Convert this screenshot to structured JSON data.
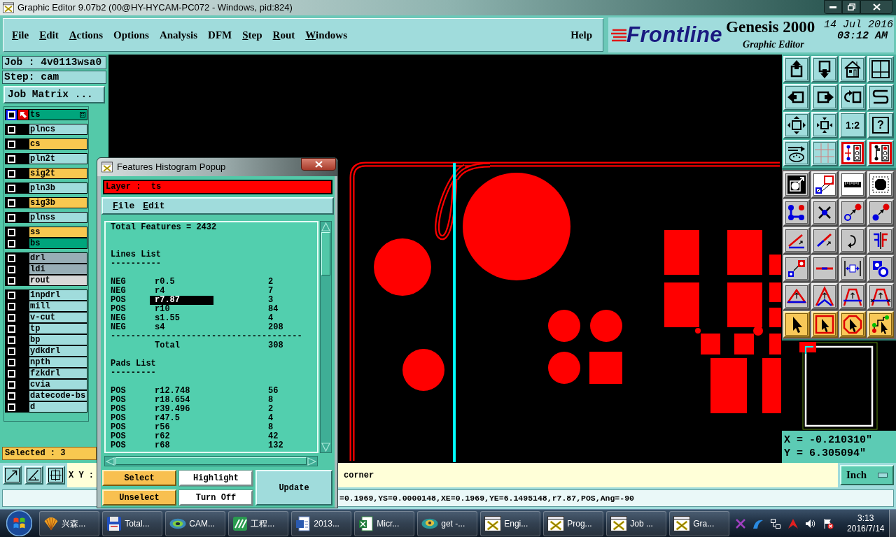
{
  "window": {
    "title": "Graphic Editor 9.07b2 (00@HY-HYCAM-PC072 - Windows, pid:824)"
  },
  "menu": [
    {
      "label": "File",
      "mnemonic": true
    },
    {
      "label": "Edit",
      "mnemonic": true
    },
    {
      "label": "Actions",
      "mnemonic": true
    },
    {
      "label": "Options",
      "mnemonic": false
    },
    {
      "label": "Analysis",
      "mnemonic": false
    },
    {
      "label": "DFM",
      "mnemonic": false
    },
    {
      "label": "Step",
      "mnemonic": true
    },
    {
      "label": "Rout",
      "mnemonic": true
    },
    {
      "label": "Windows",
      "mnemonic": true
    }
  ],
  "help_menu": {
    "label": "Help",
    "mnemonic": false
  },
  "brand": {
    "logo": "Frontline",
    "product": "Genesis 2000",
    "subtitle": "Graphic Editor",
    "date": "14 Jul 2016",
    "time": "03:12 AM"
  },
  "job_panel": {
    "job": "Job : 4v0113wsa0",
    "step": "Step: cam",
    "matrix_button": "Job Matrix ..."
  },
  "layer_groups": [
    {
      "layers": [
        {
          "name": "ts",
          "color": "#00a57c",
          "checked": false,
          "selected": true
        }
      ]
    },
    {
      "layers": [
        {
          "name": "plncs",
          "color": "#a0dcdc",
          "checked": false,
          "selected": false
        }
      ]
    },
    {
      "layers": [
        {
          "name": "cs",
          "color": "#f8c850",
          "checked": false,
          "selected": false
        }
      ]
    },
    {
      "layers": [
        {
          "name": "pln2t",
          "color": "#a0dcdc",
          "checked": false,
          "selected": false
        }
      ]
    },
    {
      "layers": [
        {
          "name": "sig2t",
          "color": "#f8c850",
          "checked": false,
          "selected": false
        }
      ]
    },
    {
      "layers": [
        {
          "name": "pln3b",
          "color": "#a0dcdc",
          "checked": false,
          "selected": false
        }
      ]
    },
    {
      "layers": [
        {
          "name": "sig3b",
          "color": "#f8c850",
          "checked": false,
          "selected": false
        }
      ]
    },
    {
      "layers": [
        {
          "name": "plnss",
          "color": "#a0dcdc",
          "checked": false,
          "selected": false
        }
      ]
    },
    {
      "layers": [
        {
          "name": "ss",
          "color": "#f8c850",
          "checked": false,
          "selected": false
        },
        {
          "name": "bs",
          "color": "#00a57c",
          "checked": false,
          "selected": false
        }
      ]
    },
    {
      "layers": [
        {
          "name": "drl",
          "color": "#98aeb6",
          "checked": false,
          "selected": false
        },
        {
          "name": "ldi",
          "color": "#98aeb6",
          "checked": false,
          "selected": false
        },
        {
          "name": "rout",
          "color": "#d8d8d8",
          "checked": false,
          "selected": false
        }
      ]
    },
    {
      "layers": [
        {
          "name": "1npdrl",
          "color": "#a0dcdc",
          "checked": false,
          "selected": false
        },
        {
          "name": "mill",
          "color": "#a0dcdc",
          "checked": false,
          "selected": false
        },
        {
          "name": "v-cut",
          "color": "#a0dcdc",
          "checked": false,
          "selected": false
        },
        {
          "name": "tp",
          "color": "#a0dcdc",
          "checked": false,
          "selected": false
        },
        {
          "name": "bp",
          "color": "#a0dcdc",
          "checked": false,
          "selected": false
        },
        {
          "name": "ydkdrl",
          "color": "#a0dcdc",
          "checked": false,
          "selected": false
        },
        {
          "name": "npth",
          "color": "#a0dcdc",
          "checked": false,
          "selected": false
        },
        {
          "name": "fzkdrl",
          "color": "#a0dcdc",
          "checked": false,
          "selected": false
        },
        {
          "name": "cvia",
          "color": "#a0dcdc",
          "checked": false,
          "selected": false
        },
        {
          "name": "datecode-bs",
          "color": "#a0dcdc",
          "checked": false,
          "selected": false
        },
        {
          "name": "d",
          "color": "#a0dcdc",
          "checked": false,
          "selected": false
        }
      ]
    }
  ],
  "selected_count": "Selected : 3",
  "histogram_popup": {
    "title": "Features Histogram Popup",
    "layer": "Layer :  ts",
    "menu": [
      {
        "label": "File",
        "mnemonic": true
      },
      {
        "label": "Edit",
        "mnemonic": true
      }
    ],
    "total": "Total Features = 2432",
    "sections": [
      {
        "title": "Lines List",
        "underline": "----------",
        "rows": [
          {
            "polarity": "NEG",
            "symbol": "r0.5",
            "count": "2",
            "selected": false
          },
          {
            "polarity": "NEG",
            "symbol": "r4",
            "count": "7",
            "selected": false
          },
          {
            "polarity": "POS",
            "symbol": "r7.87",
            "count": "3",
            "selected": true
          },
          {
            "polarity": "POS",
            "symbol": "r10",
            "count": "84",
            "selected": false
          },
          {
            "polarity": "NEG",
            "symbol": "s1.55",
            "count": "4",
            "selected": false
          },
          {
            "polarity": "NEG",
            "symbol": "s4",
            "count": "208",
            "selected": false
          }
        ],
        "rule": "--------------------------------------",
        "total_label": "Total",
        "total": "308"
      },
      {
        "title": "Pads List",
        "underline": "---------",
        "rows": [
          {
            "polarity": "POS",
            "symbol": "r12.748",
            "count": "56",
            "selected": false
          },
          {
            "polarity": "POS",
            "symbol": "r18.654",
            "count": "8",
            "selected": false
          },
          {
            "polarity": "POS",
            "symbol": "r39.496",
            "count": "2",
            "selected": false
          },
          {
            "polarity": "POS",
            "symbol": "r47.5",
            "count": "4",
            "selected": false
          },
          {
            "polarity": "POS",
            "symbol": "r56",
            "count": "8",
            "selected": false
          },
          {
            "polarity": "POS",
            "symbol": "r62",
            "count": "42",
            "selected": false
          },
          {
            "polarity": "POS",
            "symbol": "r68",
            "count": "132",
            "selected": false
          }
        ]
      }
    ],
    "buttons": [
      {
        "label": "Select",
        "kind": "selection"
      },
      {
        "label": "Highlight",
        "kind": "display"
      },
      {
        "label": "Update",
        "kind": "refresh"
      },
      {
        "label": "Unselect",
        "kind": "selection"
      },
      {
        "label": "Turn Off",
        "kind": "display"
      }
    ]
  },
  "toolbar": {
    "scale_label": "1:2",
    "help_label": "?"
  },
  "coordinates": {
    "x": "X = -0.210310\"",
    "y": "Y = 6.305094\""
  },
  "command_bar": {
    "label": "X Y :",
    "prompt": "corner",
    "units": "Inch"
  },
  "status_line": "=0.1969,YS=0.0000148,XE=0.1969,YE=6.1495148,r7.87,POS,Ang=-90",
  "taskbar": {
    "tasks": [
      {
        "label": "兴森...",
        "kind": "shell"
      },
      {
        "label": "Total...",
        "kind": "floppy"
      },
      {
        "label": "CAM...",
        "kind": "cam"
      },
      {
        "label": "工程...",
        "kind": "logo"
      },
      {
        "label": "2013...",
        "kind": "word"
      },
      {
        "label": "Micr...",
        "kind": "excel"
      },
      {
        "label": "get -...",
        "kind": "get"
      },
      {
        "label": "Engi...",
        "kind": "xwin"
      },
      {
        "label": "Prog...",
        "kind": "xwin"
      },
      {
        "label": "Job ...",
        "kind": "xwin"
      },
      {
        "label": "Gra...",
        "kind": "xwin"
      }
    ],
    "clock": {
      "time": "3:13",
      "date": "2016/7/14"
    }
  }
}
